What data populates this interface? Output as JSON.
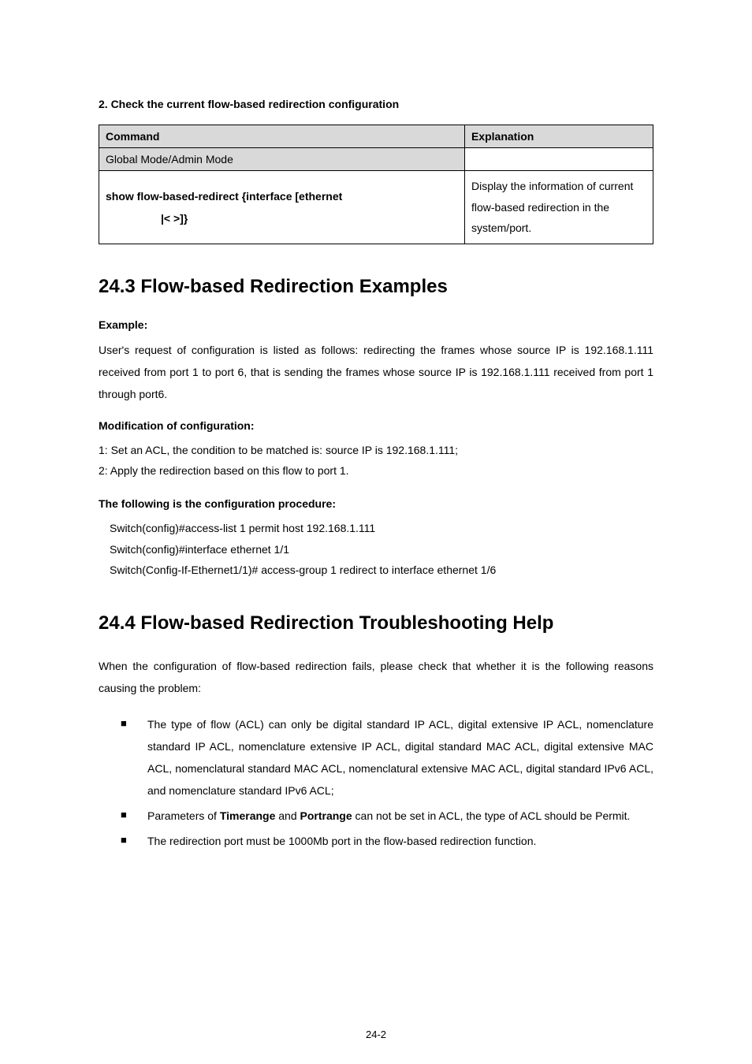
{
  "p_intro2": "2. Check the current flow-based redirection configuration",
  "table2": {
    "header": {
      "c1": "Command",
      "c2": "Explanation"
    },
    "row1": {
      "c1": "Global Mode/Admin Mode",
      "c2": ""
    },
    "row2": {
      "c1_l1": "show flow-based-redirect {interface [ethernet",
      "c1_l2": "|<            >]}",
      "c2": "Display the information of current flow-based redirection in the system/port."
    }
  },
  "h2_243": "24.3 Flow-based Redirection Examples",
  "example_lbl": "Example:",
  "example_body": "User's request of configuration is listed as follows: redirecting the frames whose source IP is 192.168.1.111 received from port 1 to port 6, that is sending the frames whose source IP is 192.168.1.111 received from port 1 through port6.",
  "mod_lbl": "Modification of configuration:",
  "mod_l1": "1: Set an ACL, the condition to be matched is: source IP is 192.168.1.111;",
  "mod_l2": "2: Apply the redirection based on this flow to port 1.",
  "proc_lbl": "The following is the configuration procedure:",
  "proc_l1": "Switch(config)#access-list 1 permit host 192.168.1.111",
  "proc_l2": "Switch(config)#interface ethernet 1/1",
  "proc_l3": "Switch(Config-If-Ethernet1/1)# access-group 1 redirect to interface ethernet 1/6",
  "h2_244": "24.4 Flow-based Redirection Troubleshooting Help",
  "ts_intro": "When the configuration of flow-based redirection fails, please check that whether it is the following reasons causing the problem:",
  "b1": "The type of flow (ACL) can only be digital standard IP ACL, digital extensive IP ACL, nomenclature standard IP ACL, nomenclature extensive IP ACL, digital standard MAC ACL, digital extensive MAC ACL, nomenclatural standard MAC ACL, nomenclatural extensive MAC ACL, digital standard IPv6 ACL, and nomenclature standard IPv6 ACL;",
  "b2_a": "Parameters of ",
  "b2_b": "Timerange",
  "b2_c": " and ",
  "b2_d": "Portrange",
  "b2_e": " can not be set in ACL, the type of ACL should be Permit.",
  "b3": "The redirection port must be 1000Mb port in the flow-based redirection function.",
  "pagenum": "24-2"
}
